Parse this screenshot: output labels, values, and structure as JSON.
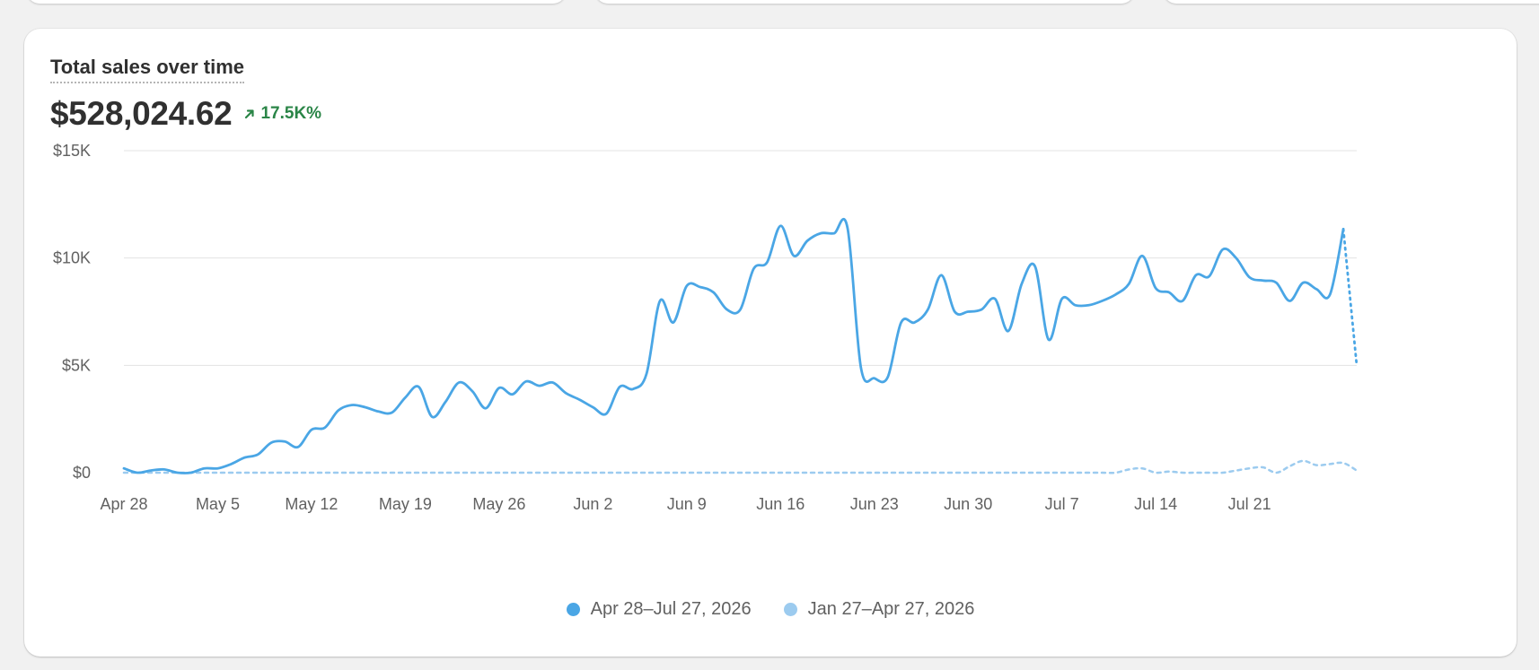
{
  "card": {
    "title": "Total sales over time",
    "total": "$528,024.62",
    "delta": "17.5K%",
    "delta_direction": "up",
    "delta_color": "#2a8547"
  },
  "colors": {
    "current": "#4aa6e5",
    "previous": "#9ccbef",
    "grid": "#e3e3e3",
    "tick_text": "#616161"
  },
  "chart_data": {
    "type": "line",
    "title": "Total sales over time",
    "xlabel": "",
    "ylabel": "",
    "y_ticks": [
      0,
      5000,
      10000,
      15000
    ],
    "y_tick_labels": [
      "$0",
      "$5K",
      "$10K",
      "$15K"
    ],
    "ylim": [
      0,
      15000
    ],
    "x_ticks": [
      {
        "day": 0,
        "label": "Apr 28"
      },
      {
        "day": 7,
        "label": "May 5"
      },
      {
        "day": 14,
        "label": "May 12"
      },
      {
        "day": 21,
        "label": "May 19"
      },
      {
        "day": 28,
        "label": "May 26"
      },
      {
        "day": 35,
        "label": "Jun 2"
      },
      {
        "day": 42,
        "label": "Jun 9"
      },
      {
        "day": 49,
        "label": "Jun 16"
      },
      {
        "day": 56,
        "label": "Jun 23"
      },
      {
        "day": 63,
        "label": "Jun 30"
      },
      {
        "day": 70,
        "label": "Jul 7"
      },
      {
        "day": 77,
        "label": "Jul 14"
      },
      {
        "day": 84,
        "label": "Jul 21"
      }
    ],
    "grid": true,
    "legend_position": "bottom",
    "series": [
      {
        "name": "Apr 28–Jul 27, 2026",
        "style": "solid",
        "last_point_dotted": true,
        "values": [
          200,
          0,
          100,
          150,
          0,
          0,
          200,
          200,
          400,
          700,
          850,
          1400,
          1450,
          1200,
          2000,
          2100,
          2900,
          3150,
          3050,
          2850,
          2800,
          3500,
          4000,
          2600,
          3300,
          4200,
          3800,
          3000,
          3950,
          3650,
          4250,
          4050,
          4200,
          3700,
          3400,
          3050,
          2750,
          4000,
          3900,
          4600,
          8000,
          7000,
          8700,
          8650,
          8400,
          7600,
          7600,
          9500,
          9800,
          11500,
          10100,
          10800,
          11150,
          11150,
          11400,
          4900,
          4400,
          4450,
          7000,
          7000,
          7600,
          9200,
          7500,
          7500,
          7600,
          8100,
          6600,
          8800,
          9600,
          6200,
          8100,
          7800,
          7800,
          8000,
          8300,
          8800,
          10100,
          8600,
          8400,
          8000,
          9200,
          9150,
          10400,
          10000,
          9100,
          8950,
          8850,
          8000,
          8850,
          8550,
          8300,
          11350,
          5000
        ]
      },
      {
        "name": "Jan 27–Apr 27, 2026",
        "style": "dashed",
        "values": [
          0,
          0,
          0,
          0,
          0,
          0,
          0,
          0,
          0,
          0,
          0,
          0,
          0,
          0,
          0,
          0,
          0,
          0,
          0,
          0,
          0,
          0,
          0,
          0,
          0,
          0,
          0,
          0,
          0,
          0,
          0,
          0,
          0,
          0,
          0,
          0,
          0,
          0,
          0,
          0,
          0,
          0,
          0,
          0,
          0,
          0,
          0,
          0,
          0,
          0,
          0,
          0,
          0,
          0,
          0,
          0,
          0,
          0,
          0,
          0,
          0,
          0,
          0,
          0,
          0,
          0,
          0,
          0,
          0,
          0,
          0,
          0,
          0,
          0,
          0,
          150,
          200,
          0,
          50,
          0,
          0,
          0,
          0,
          100,
          200,
          250,
          0,
          300,
          550,
          350,
          400,
          450,
          100
        ]
      }
    ]
  }
}
